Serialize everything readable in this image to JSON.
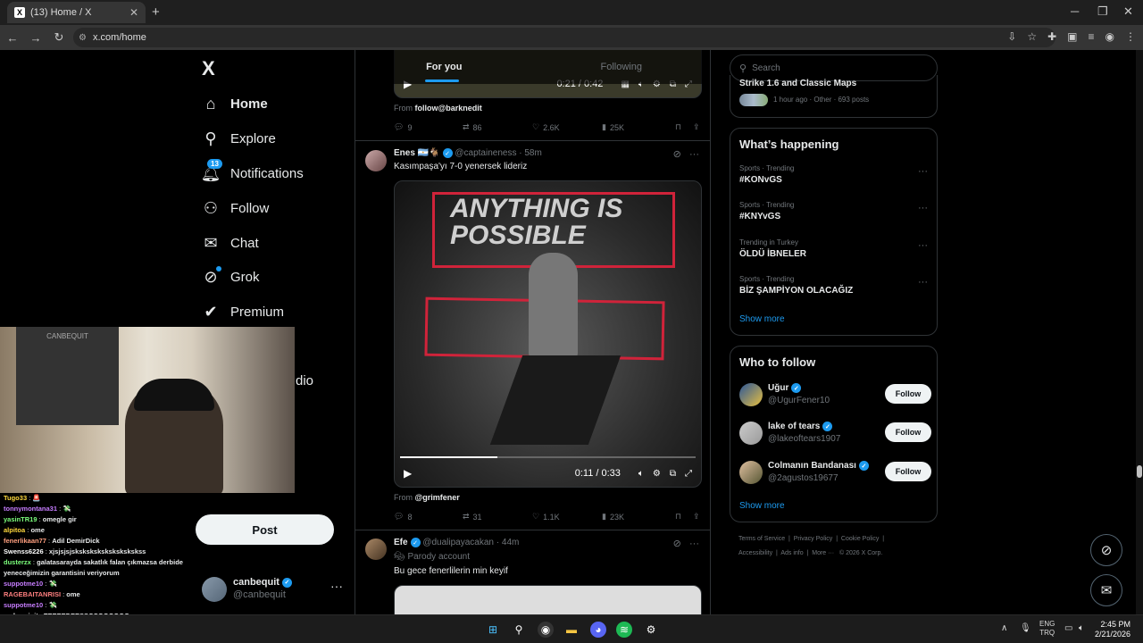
{
  "browser": {
    "tab_title": "(13) Home / X",
    "tab_favicon": "X",
    "url": "x.com/home"
  },
  "nav": {
    "logo": "X",
    "items": [
      {
        "label": "Home",
        "icon": "home-icon"
      },
      {
        "label": "Explore",
        "icon": "search-icon"
      },
      {
        "label": "Notifications",
        "icon": "bell-icon",
        "badge": "13"
      },
      {
        "label": "Follow",
        "icon": "person-add-icon"
      },
      {
        "label": "Chat",
        "icon": "mail-icon"
      },
      {
        "label": "Grok",
        "icon": "grok-icon"
      },
      {
        "label": "Premium",
        "icon": "premium-icon"
      }
    ],
    "hidden_item_tail": "dio",
    "post_label": "Post",
    "account": {
      "name": "canbequit",
      "handle": "@canbequit"
    }
  },
  "feed": {
    "tabs": [
      "For you",
      "Following"
    ],
    "tweet0": {
      "video_time": "0:21 / 0:42",
      "from_prefix": "From",
      "from_source": "follow@barknedit",
      "replies": "9",
      "reposts": "86",
      "likes": "2.6K",
      "views": "25K"
    },
    "tweet1": {
      "name": "Enes",
      "flags": "🇦🇷🐐",
      "handle": "@captaineness",
      "time": "58m",
      "text": "Kasımpaşa'yı 7-0 yenersek lideriz",
      "video_overlay_text": "ANYTHING IS POSSIBLE",
      "video_time": "0:11 / 0:33",
      "video_progress": 0.33,
      "from_prefix": "From",
      "from_source": "@grimfener",
      "replies": "8",
      "reposts": "31",
      "likes": "1.1K",
      "views": "23K"
    },
    "tweet2": {
      "name": "Efe",
      "handle": "@dualipayacakan",
      "time": "44m",
      "label": "Parody account",
      "text": "Bu gece fenerlilerin min keyif"
    }
  },
  "sidebar": {
    "search_placeholder": "Search",
    "top_card": {
      "title": "Strike 1.6 and Classic Maps",
      "meta": "1 hour ago · Other · 693 posts"
    },
    "happening": {
      "title": "What’s happening",
      "trends": [
        {
          "meta": "Sports · Trending",
          "name": "#KONvGS"
        },
        {
          "meta": "Sports · Trending",
          "name": "#KNYvGS"
        },
        {
          "meta": "Trending in Turkey",
          "name": "ÖLDÜ İBNELER"
        },
        {
          "meta": "Sports · Trending",
          "name": "BİZ ŞAMPİYON OLACAĞIZ"
        }
      ],
      "show_more": "Show more"
    },
    "who_to_follow": {
      "title": "Who to follow",
      "users": [
        {
          "name": "Uğur",
          "handle": "@UgurFener10",
          "button": "Follow"
        },
        {
          "name": "lake of tears",
          "handle": "@lakeoftears1907",
          "button": "Follow"
        },
        {
          "name": "Colmanın Bandanası",
          "handle": "@2agustos19677",
          "button": "Follow"
        }
      ],
      "show_more": "Show more"
    },
    "footer": {
      "row1": [
        "Terms of Service",
        "Privacy Policy",
        "Cookie Policy"
      ],
      "row2": [
        "Accessibility",
        "Ads info",
        "More ···",
        "© 2026 X Corp."
      ]
    }
  },
  "overlay": {
    "poster_text": "CANBEQUIT",
    "chat": [
      {
        "user": "Tugo33",
        "msg": "🚨",
        "color": "#ffd93d"
      },
      {
        "user": "tonnymontana31",
        "msg": "💸",
        "color": "#c77dff"
      },
      {
        "user": "yasinTR19",
        "msg": "omegle gir",
        "color": "#7cff7c"
      },
      {
        "user": "alpitoa",
        "msg": "ome",
        "color": "#ffd93d"
      },
      {
        "user": "fenerlikaan77",
        "msg": "Adil DemirDick",
        "color": "#ff9f7f"
      },
      {
        "user": "Swenss6226",
        "msg": "xjsjsjsjskskskskskskskskskss",
        "color": "#ffffff"
      },
      {
        "user": "dusterzx",
        "msg": "galatasarayda sakatlık falan çıkmazsa derbide yeneceğimizin garantisini veriyorum",
        "color": "#7cff7c"
      },
      {
        "user": "suppotme10",
        "msg": "💸",
        "color": "#c77dff"
      },
      {
        "user": "RAGEBAITANRISI",
        "msg": "ome",
        "color": "#ff7f7f"
      },
      {
        "user": "suppotme10",
        "msg": "💸",
        "color": "#c77dff"
      },
      {
        "user": "mckayyigit",
        "msg": "TEEEEDEESSCCOOOOOO",
        "color": "#ffffff"
      }
    ]
  },
  "taskbar": {
    "lang_top": "ENG",
    "lang_bottom": "TRQ",
    "time": "2:45 PM",
    "date": "2/21/2026"
  },
  "colors": {
    "accent": "#1d9bf0",
    "bg": "#000000",
    "border": "#2f3336",
    "muted": "#71767b"
  }
}
